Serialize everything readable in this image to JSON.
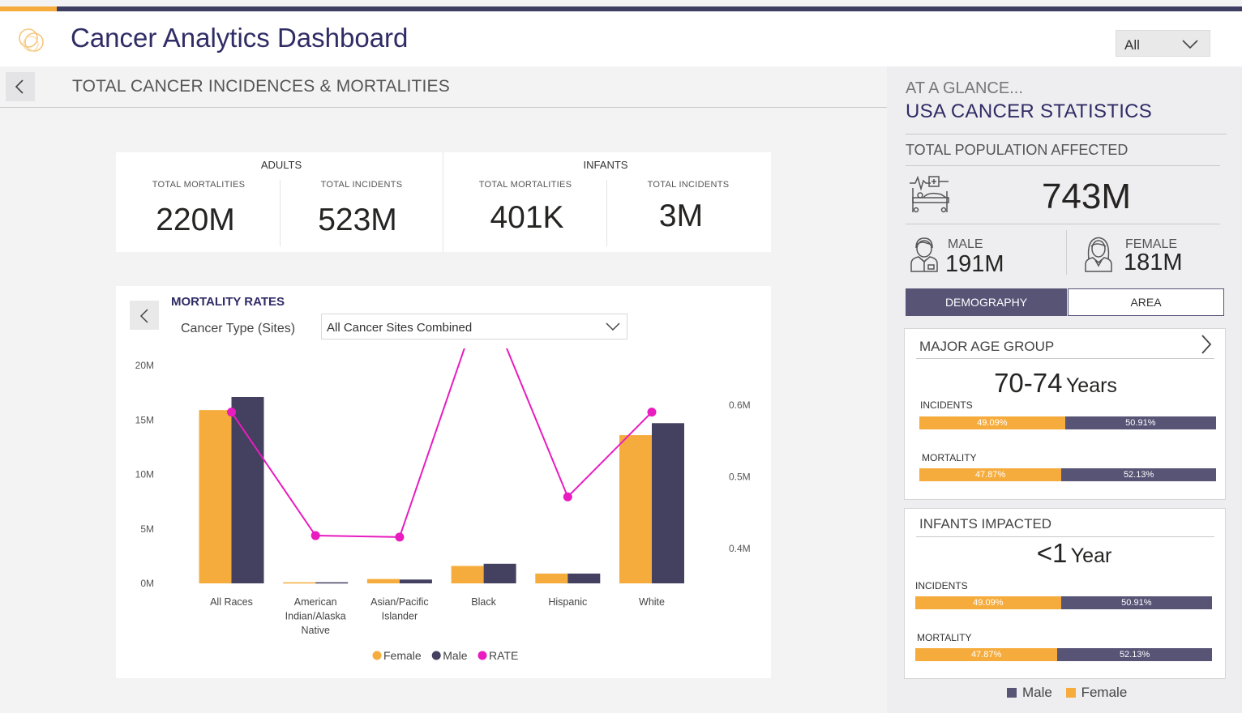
{
  "header": {
    "title": "Cancer Analytics Dashboard",
    "filter_value": "All"
  },
  "section": {
    "title": "TOTAL CANCER INCIDENCES & MORTALITIES"
  },
  "kpis": {
    "adults": {
      "label": "ADULTS",
      "mortalities_label": "TOTAL MORTALITIES",
      "mortalities_value": "220M",
      "incidents_label": "TOTAL INCIDENTS",
      "incidents_value": "523M"
    },
    "infants": {
      "label": "INFANTS",
      "mortalities_label": "TOTAL MORTALITIES",
      "mortalities_value": "401K",
      "incidents_label": "TOTAL INCIDENTS",
      "incidents_value": "3M"
    }
  },
  "mortality": {
    "title": "MORTALITY RATES",
    "cancer_type_label": "Cancer Type (Sites)",
    "cancer_type_value": "All Cancer Sites Combined"
  },
  "chart_data": {
    "type": "bar",
    "categories": [
      [
        "All Races"
      ],
      [
        "American",
        "Indian/Alaska",
        "Native"
      ],
      [
        "Asian/Pacific",
        "Islander"
      ],
      [
        "Black"
      ],
      [
        "Hispanic"
      ],
      [
        "White"
      ]
    ],
    "series": [
      {
        "name": "Female",
        "type": "bar",
        "axis": "left",
        "color": "#f6ac3c",
        "values": [
          15.9,
          0.1,
          0.4,
          1.6,
          0.9,
          13.6
        ]
      },
      {
        "name": "Male",
        "type": "bar",
        "axis": "left",
        "color": "#434060",
        "values": [
          17.1,
          0.1,
          0.35,
          1.8,
          0.9,
          14.7
        ]
      },
      {
        "name": "RATE",
        "type": "line",
        "axis": "right",
        "color": "#e81cbf",
        "values": [
          0.59,
          0.418,
          0.416,
          0.757,
          0.472,
          0.59
        ]
      }
    ],
    "left_axis": {
      "ticks": [
        0,
        5,
        10,
        15,
        20
      ],
      "tick_labels": [
        "0M",
        "5M",
        "10M",
        "15M",
        "20M"
      ],
      "range": [
        0,
        20
      ]
    },
    "right_axis": {
      "ticks": [
        0.4,
        0.5,
        0.6
      ],
      "tick_labels": [
        "0.4M",
        "0.5M",
        "0.6M"
      ],
      "range": [
        0.3,
        0.8
      ]
    },
    "legend": [
      "Female",
      "Male",
      "RATE"
    ],
    "legend_position": "bottom-center",
    "grid": false
  },
  "glance": {
    "subtitle": "AT A GLANCE...",
    "title": "USA CANCER STATISTICS",
    "population_label": "TOTAL POPULATION AFFECTED",
    "population_value": "743M",
    "male_label": "MALE",
    "male_value": "191M",
    "female_label": "FEMALE",
    "female_value": "181M"
  },
  "tabs": {
    "demography": "DEMOGRAPHY",
    "area": "AREA"
  },
  "age_group": {
    "title": "MAJOR AGE GROUP",
    "value": "70-74",
    "unit": "Years",
    "incidents_label": "INCIDENTS",
    "incidents_female_pct": 49.09,
    "incidents_female": "49.09%",
    "incidents_male": "50.91%",
    "mortality_label": "MORTALITY",
    "mortality_female_pct": 47.87,
    "mortality_female": "47.87%",
    "mortality_male": "52.13%"
  },
  "infants": {
    "title": "INFANTS IMPACTED",
    "value": "<1",
    "unit": "Year",
    "incidents_label": "INCIDENTS",
    "incidents_female_pct": 49.09,
    "incidents_female": "49.09%",
    "incidents_male": "50.91%",
    "mortality_label": "MORTALITY",
    "mortality_female_pct": 47.87,
    "mortality_female": "47.87%",
    "mortality_male": "52.13%"
  },
  "bottom_legend": {
    "male": "Male",
    "female": "Female"
  },
  "colors": {
    "female": "#f6ac3c",
    "male": "#575476",
    "rate": "#e81cbf",
    "title": "#2f2c66"
  }
}
